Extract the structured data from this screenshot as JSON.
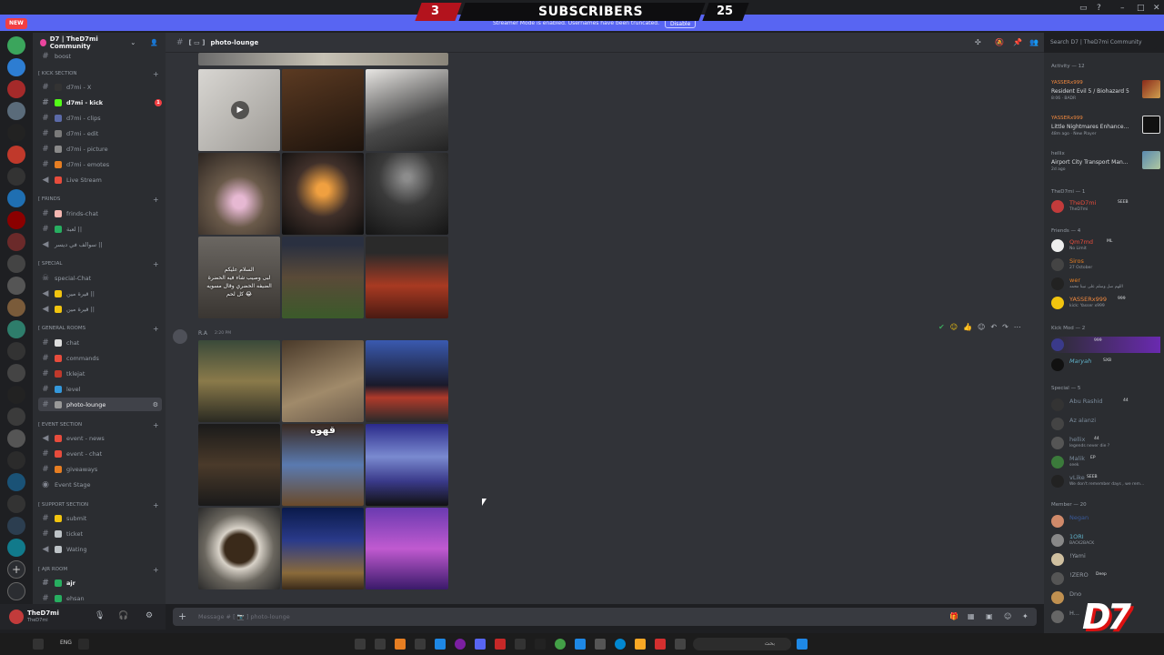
{
  "banner": {
    "new_label": "NEW",
    "streamer_text": "Streamer Mode is enabled. Usernames have been truncated.",
    "disable_label": "Disable",
    "subs_left": "3",
    "subs_title": "SUBSCRIBERS",
    "subs_right": "25"
  },
  "server": {
    "name": "D7 | TheD7mi Community",
    "channel": "photo-lounge"
  },
  "sidebar": {
    "categories": [
      {
        "label": "[ KICK SECTION"
      },
      {
        "label": "[ FRINDS"
      },
      {
        "label": "[ SPECIAL"
      },
      {
        "label": "[ GENERAL ROOMS"
      },
      {
        "label": "[ EVENT SECTION"
      },
      {
        "label": "[ SUPPORT SECTION"
      },
      {
        "label": "[ AJR ROOM"
      }
    ],
    "channels": [
      {
        "label": "boost"
      },
      {
        "label": "d7mi - X"
      },
      {
        "label": "d7mi - kick"
      },
      {
        "label": "d7mi - clips"
      },
      {
        "label": "d7mi - edit"
      },
      {
        "label": "d7mi - picture"
      },
      {
        "label": "d7mi - emotes"
      },
      {
        "label": "Live Stream"
      },
      {
        "label": "frinds-chat"
      },
      {
        "label": "لعبة ||"
      },
      {
        "label": "سوالف في ديسر ||"
      },
      {
        "label": "special-Chat"
      },
      {
        "label": "قيرة مين ||"
      },
      {
        "label": "قيرة مين ||"
      },
      {
        "label": "chat"
      },
      {
        "label": "commands"
      },
      {
        "label": "tklejat"
      },
      {
        "label": "level"
      },
      {
        "label": "photo-lounge"
      },
      {
        "label": "event - news"
      },
      {
        "label": "event - chat"
      },
      {
        "label": "giveaways"
      },
      {
        "label": "Event Stage"
      },
      {
        "label": "submit"
      },
      {
        "label": "ticket"
      },
      {
        "label": "Wating"
      },
      {
        "label": "ajr"
      },
      {
        "label": "ehsan"
      }
    ],
    "kick_badge": "1"
  },
  "user": {
    "name": "TheD7mi",
    "status": "TheD7mi"
  },
  "header": {
    "search_placeholder": "Search D7 | TheD7mi Community"
  },
  "chat": {
    "author": "R.A",
    "time": "2:20 PM",
    "overlay_text": "السلام عليكم\nلبى وصيب شاء فيه الحضرة\nالضيفه الحضري وقال مسويه\nكل لحم 😂",
    "cafe_sign": "قهوه"
  },
  "composer": {
    "placeholder": "Message # [ 📷 ] photo-lounge"
  },
  "members": {
    "activity_header": "Activity — 12",
    "activities": [
      {
        "user": "YASSERx999",
        "game": "Resident Evil 5 / Biohazard 5",
        "meta": "8:06 · BADR"
      },
      {
        "user": "YASSERx999",
        "game": "Little Nightmares Enhance...",
        "meta": "48m ago · New Player"
      },
      {
        "user": "hellix",
        "game": "Airport City Transport Man...",
        "meta": "2d ago"
      }
    ],
    "sections": [
      {
        "label": "TheD7mi — 1"
      },
      {
        "label": "Friends — 4"
      },
      {
        "label": "Kick Mod — 2"
      },
      {
        "label": "Special — 5"
      },
      {
        "label": "Member — 20"
      }
    ],
    "list": [
      {
        "name": "TheD7mi",
        "sub": "TheD7mi",
        "tag": "SEEB"
      },
      {
        "name": "Qm7md",
        "sub": "No Limit",
        "tag": "ML"
      },
      {
        "name": "Siros",
        "sub": "27 October",
        "tag": ""
      },
      {
        "name": "wer",
        "sub": "اللهم صل وسلم على نبينا محمد",
        "tag": ""
      },
      {
        "name": "YASSERx999",
        "sub": "kick: Yasser x999",
        "tag": "999"
      },
      {
        "name": "—",
        "sub": "",
        "tag": "999"
      },
      {
        "name": "Maryah",
        "sub": "",
        "tag": "SXB"
      },
      {
        "name": "Abu Rashid",
        "sub": "",
        "tag": "44"
      },
      {
        "name": "Az alanzi",
        "sub": "",
        "tag": ""
      },
      {
        "name": "hellix",
        "sub": "legends never die ?",
        "tag": "44"
      },
      {
        "name": "Malik",
        "sub": "seek",
        "tag": "EP"
      },
      {
        "name": "vLike",
        "sub": "We don't remember days , we rem...",
        "tag": "SEEB"
      },
      {
        "name": "Negan",
        "sub": "",
        "tag": ""
      },
      {
        "name": "1ORI",
        "sub": "BACK2BACK",
        "tag": ""
      },
      {
        "name": "!Yami",
        "sub": "",
        "tag": ""
      },
      {
        "name": "!ZERO",
        "sub": "",
        "tag": "Deep"
      },
      {
        "name": "Dno",
        "sub": "",
        "tag": ""
      },
      {
        "name": "H...",
        "sub": "",
        "tag": ""
      }
    ]
  },
  "taskbar": {
    "lang": "ENG",
    "search_placeholder": "بحث"
  },
  "colors": {
    "banner": "#5865f2",
    "accent_red": "#f23f43",
    "activity_user": "#f0883e"
  }
}
